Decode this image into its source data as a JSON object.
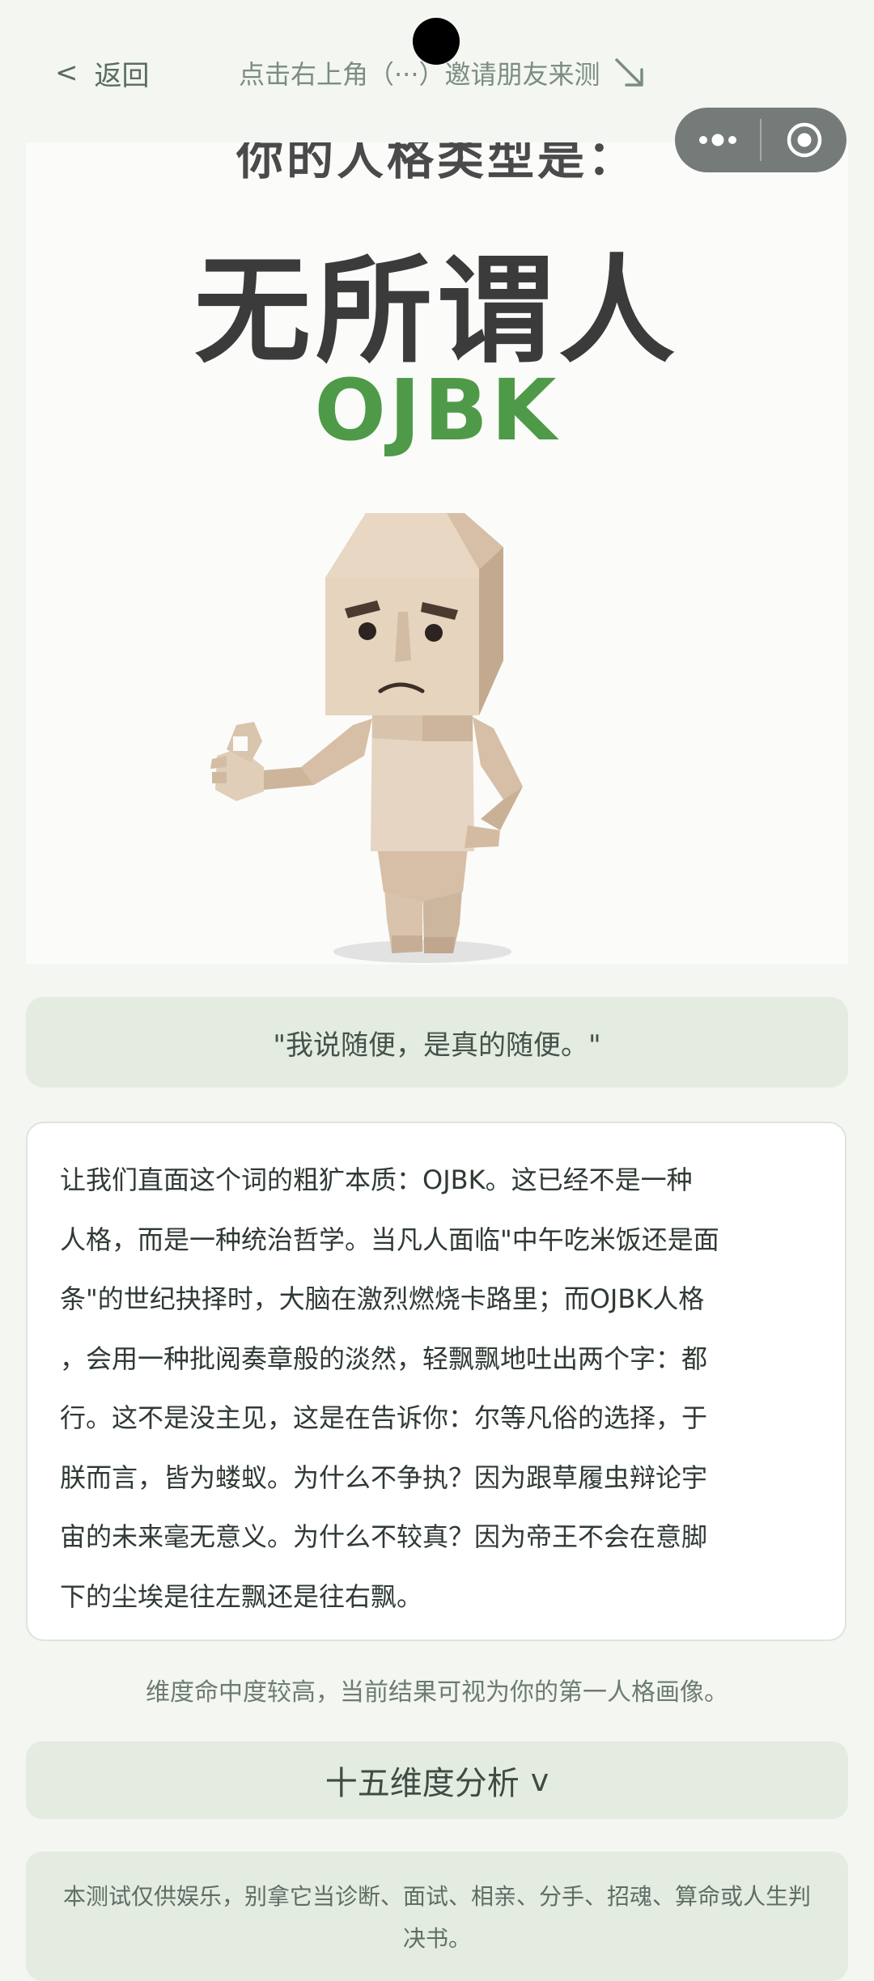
{
  "header": {
    "back_icon": "chevron-left-icon",
    "back_label": "返回",
    "invite_hint": "点击右上角（···）邀请朋友来测",
    "hint_icon": "arrow-down-right-icon"
  },
  "capsule": {
    "more_icon": "more-dots-icon",
    "close_icon": "target-circle-icon"
  },
  "result": {
    "cut_title": "你的人格类型是：",
    "type_name": "无所谓人",
    "type_code": "OJBK",
    "type_code_color": "#4e9a48",
    "figure_icon": "blocky-figure-ok-gesture"
  },
  "quote": "\"我说随便，是真的随便。\"",
  "description_lines": [
    "让我们直面这个词的粗犷本质：OJBK。这已经不是一种",
    "人格，而是一种统治哲学。当凡人面临\"中午吃米饭还是面",
    "条\"的世纪抉择时，大脑在激烈燃烧卡路里；而OJBK人格",
    "，会用一种批阅奏章般的淡然，轻飘飘地吐出两个字：都",
    "行。这不是没主见，这是在告诉你：尔等凡俗的选择，于",
    "朕而言，皆为蝼蚁。为什么不争执？因为跟草履虫辩论宇",
    "宙的未来毫无意义。为什么不较真？因为帝王不会在意脚",
    "下的尘埃是往左飘还是往右飘。"
  ],
  "match_note": "维度命中度较高，当前结果可视为你的第一人格画像。",
  "dimension_button": {
    "label": "十五维度分析",
    "icon": "chevron-down-icon",
    "chevron_text": "v"
  },
  "disclaimer": "本测试仅供娱乐，别拿它当诊断、面试、相亲、分手、招魂、算命或人生判决书。",
  "colors": {
    "background": "#f4f6f2",
    "accent_panel": "#e4ece2",
    "capsule": "#757b78"
  }
}
